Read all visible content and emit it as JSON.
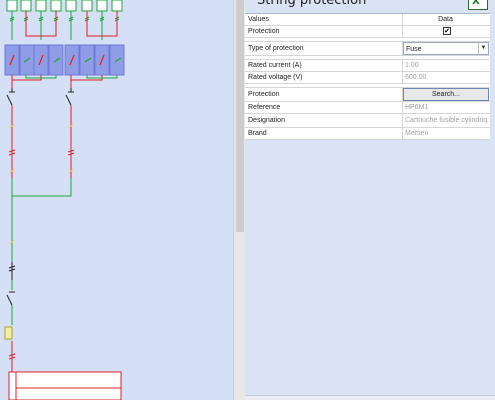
{
  "panel": {
    "title": "String protection",
    "excel_icon_letter": "X"
  },
  "grid": {
    "header": {
      "col1": "Values",
      "col2": "Data"
    },
    "rows": [
      {
        "label": "Protection",
        "value": "✔",
        "kind": "checkbox"
      },
      {
        "label": "Type of protection",
        "value": "Fuse",
        "kind": "select"
      },
      {
        "label": "Rated current (A)",
        "value": "1.00",
        "kind": "readonly"
      },
      {
        "label": "Rated voltage (V)",
        "value": "600.00",
        "kind": "readonly"
      },
      {
        "label": "Protection",
        "value": "Search...",
        "kind": "button"
      },
      {
        "label": "Reference",
        "value": "HP6M1",
        "kind": "readonly"
      },
      {
        "label": "Designation",
        "value": "Cartouche fusible cylindriq...",
        "kind": "readonly"
      },
      {
        "label": "Brand",
        "value": "Mersen",
        "kind": "readonly"
      }
    ]
  },
  "icons": {
    "check": "checkmark-icon",
    "dropdown": "chevron-down-icon",
    "excel": "excel-export-icon"
  },
  "colors": {
    "wire_green": "#1fa63a",
    "wire_red": "#e02020",
    "fuse_box": "#7f8fe0",
    "diagram_bg": "#d5e0f7"
  }
}
